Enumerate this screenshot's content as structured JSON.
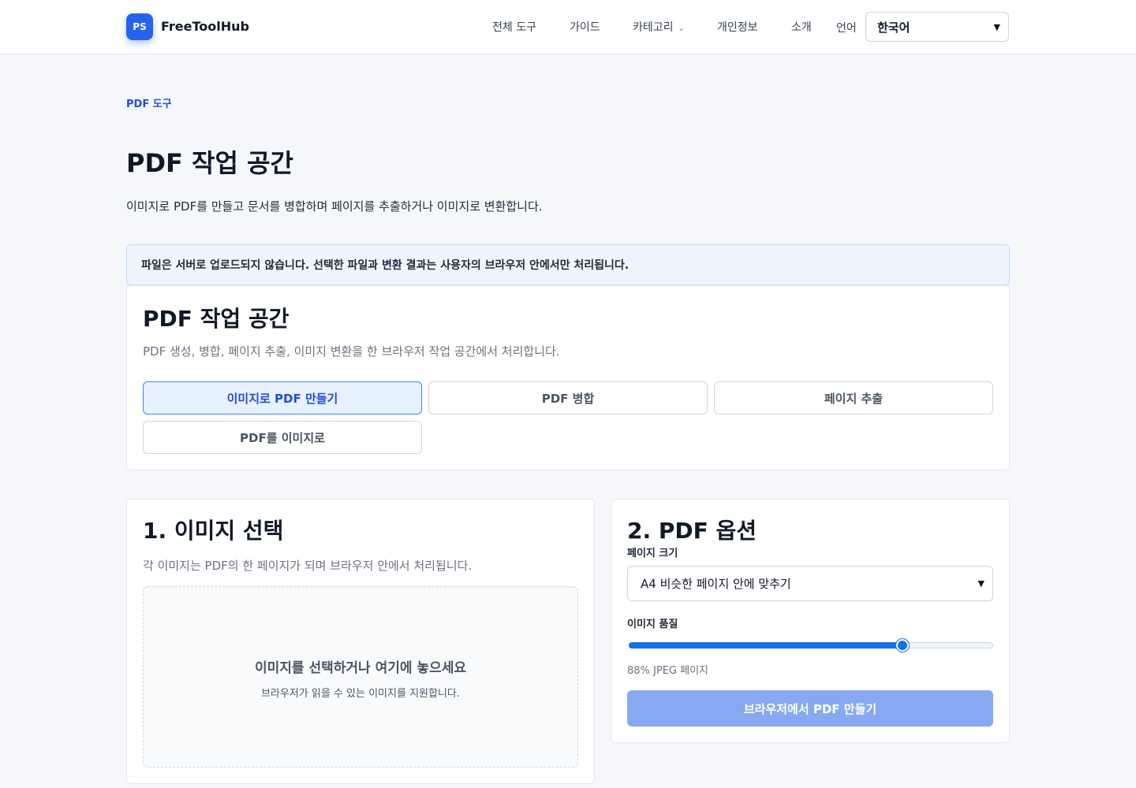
{
  "header": {
    "logo_text": "PS",
    "brand": "FreeToolHub",
    "nav": {
      "all_tools": "전체 도구",
      "guide": "가이드",
      "category": "카테고리",
      "privacy": "개인정보",
      "about": "소개"
    },
    "language_label": "언어",
    "language_value": "한국어"
  },
  "intro": {
    "eyebrow": "PDF 도구",
    "title": "PDF 작업 공간",
    "description": "이미지로 PDF를 만들고 문서를 병합하며 페이지를 추출하거나 이미지로 변환합니다."
  },
  "notice": "파일은 서버로 업로드되지 않습니다. 선택한 파일과 변환 결과는 사용자의 브라우저 안에서만 처리됩니다.",
  "workspace": {
    "title": "PDF 작업 공간",
    "description": "PDF 생성, 병합, 페이지 추출, 이미지 변환을 한 브라우저 작업 공간에서 처리합니다.",
    "tabs": [
      {
        "label": "이미지로 PDF 만들기",
        "active": true
      },
      {
        "label": "PDF 병합",
        "active": false
      },
      {
        "label": "페이지 추출",
        "active": false
      },
      {
        "label": "PDF를 이미지로",
        "active": false
      }
    ]
  },
  "step1": {
    "title": "1. 이미지 선택",
    "description": "각 이미지는 PDF의 한 페이지가 되며 브라우저 안에서 처리됩니다.",
    "dropzone_title": "이미지를 선택하거나 여기에 놓으세요",
    "dropzone_sub": "브라우저가 읽을 수 있는 이미지를 지원합니다."
  },
  "step2": {
    "title": "2. PDF 옵션",
    "page_size_label": "페이지 크기",
    "page_size_value": "A4 비슷한 페이지 안에 맞추기",
    "quality_label": "이미지 품질",
    "quality_percent": 88,
    "quality_slider_fraction": 0.75,
    "quality_note": "88% JPEG 페이지",
    "button_label": "브라우저에서 PDF 만들기"
  },
  "colors": {
    "accent": "#2563eb",
    "active_tab_bg": "#e8f1ff",
    "notice_bg": "#eef5ff",
    "disabled_button": "#86a9f2"
  },
  "icons": {
    "category_chevron": "chevron-down-icon",
    "select_caret": "chevron-down-icon"
  }
}
